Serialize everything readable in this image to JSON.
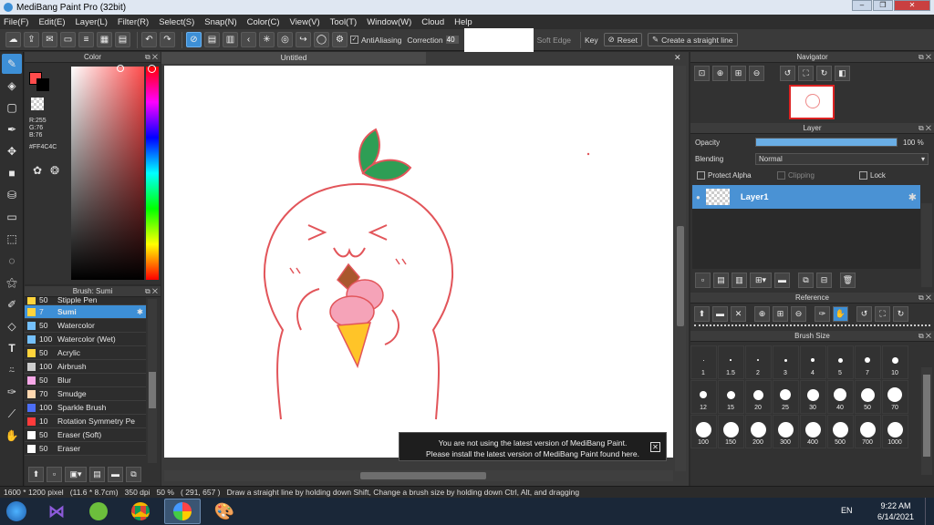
{
  "window": {
    "title": "MediBang Paint Pro (32bit)"
  },
  "menu": [
    "File(F)",
    "Edit(E)",
    "Layer(L)",
    "Filter(R)",
    "Select(S)",
    "Snap(N)",
    "Color(C)",
    "View(V)",
    "Tool(T)",
    "Window(W)",
    "Cloud",
    "Help"
  ],
  "toolbar": {
    "antialias": "AntiAliasing",
    "correction_label": "Correction",
    "correction_value": "40",
    "soft_edge": "Soft Edge",
    "key": "Key",
    "reset": "Reset",
    "straight_line": "Create a straight line"
  },
  "color_panel": {
    "title": "Color",
    "r": "R:255",
    "g": "G:76",
    "b": "B:76",
    "hex": "#FF4C4C",
    "primary": "#ff4c4c"
  },
  "brush_panel": {
    "title": "Brush: Sumi",
    "items": [
      {
        "size": "50",
        "name": "Stipple Pen",
        "color": "#ffd43b"
      },
      {
        "size": "7",
        "name": "Sumi",
        "color": "#ffd43b"
      },
      {
        "size": "50",
        "name": "Watercolor",
        "color": "#74c0fc"
      },
      {
        "size": "100",
        "name": "Watercolor (Wet)",
        "color": "#74c0fc"
      },
      {
        "size": "50",
        "name": "Acrylic",
        "color": "#ffd43b"
      },
      {
        "size": "100",
        "name": "Airbrush",
        "color": "#cccccc"
      },
      {
        "size": "50",
        "name": "Blur",
        "color": "#f7a8e8"
      },
      {
        "size": "70",
        "name": "Smudge",
        "color": "#ffd8b0"
      },
      {
        "size": "100",
        "name": "Sparkle Brush",
        "color": "#4c6ef5"
      },
      {
        "size": "10",
        "name": "Rotation Symmetry Pe",
        "color": "#ff3b3b"
      },
      {
        "size": "50",
        "name": "Eraser (Soft)",
        "color": "#ffffff"
      },
      {
        "size": "50",
        "name": "Eraser",
        "color": "#ffffff"
      }
    ]
  },
  "canvas": {
    "tab": "Untitled"
  },
  "notice": {
    "line1": "You are not using the latest version of MediBang Paint.",
    "line2": "Please install the latest version of MediBang Paint found here."
  },
  "navigator": {
    "title": "Navigator"
  },
  "layer_panel": {
    "title": "Layer",
    "opacity_label": "Opacity",
    "opacity_value": "100 %",
    "opacity_fraction": 1.0,
    "blending_label": "Blending",
    "blending_value": "Normal",
    "protect_alpha": "Protect Alpha",
    "clipping": "Clipping",
    "lock": "Lock",
    "layer_name": "Layer1"
  },
  "reference": {
    "title": "Reference"
  },
  "brush_size": {
    "title": "Brush Size",
    "sizes": [
      "1",
      "1.5",
      "2",
      "3",
      "4",
      "5",
      "7",
      "10",
      "12",
      "15",
      "20",
      "25",
      "30",
      "40",
      "50",
      "70",
      "100",
      "150",
      "200",
      "300",
      "400",
      "500",
      "700",
      "1000"
    ]
  },
  "status": {
    "text": "1600 * 1200 pixel   (11.6 * 8.7cm)   350 dpi   50 %   ( 291, 657 )   Draw a straight line by holding down Shift, Change a brush size by holding down Ctrl, Alt, and dragging"
  },
  "taskbar": {
    "lang": "EN",
    "time": "9:22 AM",
    "date": "6/14/2021"
  }
}
